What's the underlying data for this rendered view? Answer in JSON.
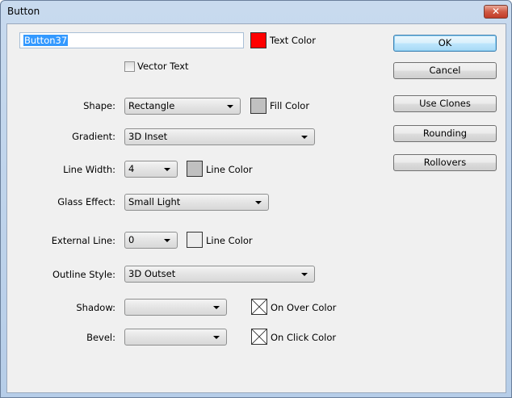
{
  "window": {
    "title": "Button",
    "close_icon": "close-icon"
  },
  "name_field": {
    "value": "Button37"
  },
  "text_color": {
    "label": "Text Color",
    "color": "#ff0000"
  },
  "vector_text": {
    "label": "Vector Text",
    "checked": false
  },
  "rows": {
    "shape": {
      "label": "Shape:",
      "value": "Rectangle",
      "color_label": "Fill Color",
      "color": "#c0c0c0"
    },
    "gradient": {
      "label": "Gradient:",
      "value": "3D Inset"
    },
    "line_width": {
      "label": "Line Width:",
      "value": "4",
      "color_label": "Line Color",
      "color": "#c0c0c0"
    },
    "glass": {
      "label": "Glass Effect:",
      "value": "Small Light"
    },
    "external_line": {
      "label": "External Line:",
      "value": "0",
      "color_label": "Line Color",
      "color": "#ececec"
    },
    "outline": {
      "label": "Outline Style:",
      "value": "3D Outset"
    },
    "shadow": {
      "label": "Shadow:",
      "value": "",
      "color_label": "On Over Color"
    },
    "bevel": {
      "label": "Bevel:",
      "value": "",
      "color_label": "On Click Color"
    }
  },
  "buttons": {
    "ok": "OK",
    "cancel": "Cancel",
    "clones": "Use Clones",
    "rounding": "Rounding",
    "rollovers": "Rollovers"
  }
}
